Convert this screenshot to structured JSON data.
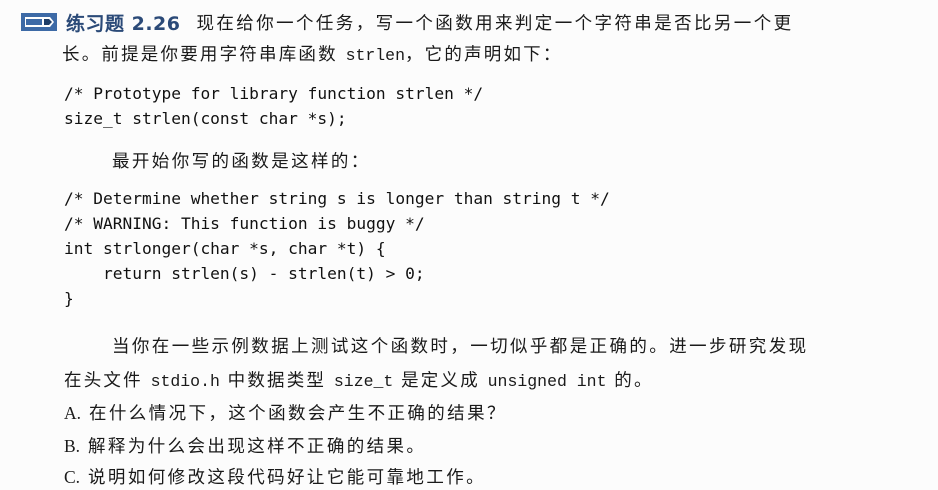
{
  "exercise": {
    "label": "练习题 2.26",
    "task_line1": "现在给你一个任务，写一个函数用来判定一个字符串是否比另一个更",
    "task_line2_pre": "长。前提是你要用字符串库函数 ",
    "task_line2_func": "strlen",
    "task_line2_post": "，它的声明如下："
  },
  "code_block_1": [
    "/* Prototype for library function strlen */",
    "size_t strlen(const char *s);"
  ],
  "intro_text": "最开始你写的函数是这样的：",
  "code_block_2": [
    "/* Determine whether string s is longer than string t */",
    "/* WARNING: This function is buggy */",
    "int strlonger(char *s, char *t) {",
    "    return strlen(s) - strlen(t) > 0;",
    "}"
  ],
  "paragraph": {
    "line1": "当你在一些示例数据上测试这个函数时，一切似乎都是正确的。进一步研究发现",
    "line2_a": "在头文件 ",
    "line2_b": "stdio.h",
    "line2_c": " 中数据类型 ",
    "line2_d": "size_t",
    "line2_e": " 是定义成 ",
    "line2_f": "unsigned int",
    "line2_g": " 的。"
  },
  "questions": [
    {
      "letter": "A.",
      "text": "在什么情况下，这个函数会产生不正确的结果？"
    },
    {
      "letter": "B.",
      "text": "解释为什么会出现这样不正确的结果。"
    },
    {
      "letter": "C.",
      "text": "说明如何修改这段代码好让它能可靠地工作。"
    }
  ],
  "colors": {
    "title": "#2b4a78",
    "icon": "#3d6aa6"
  }
}
